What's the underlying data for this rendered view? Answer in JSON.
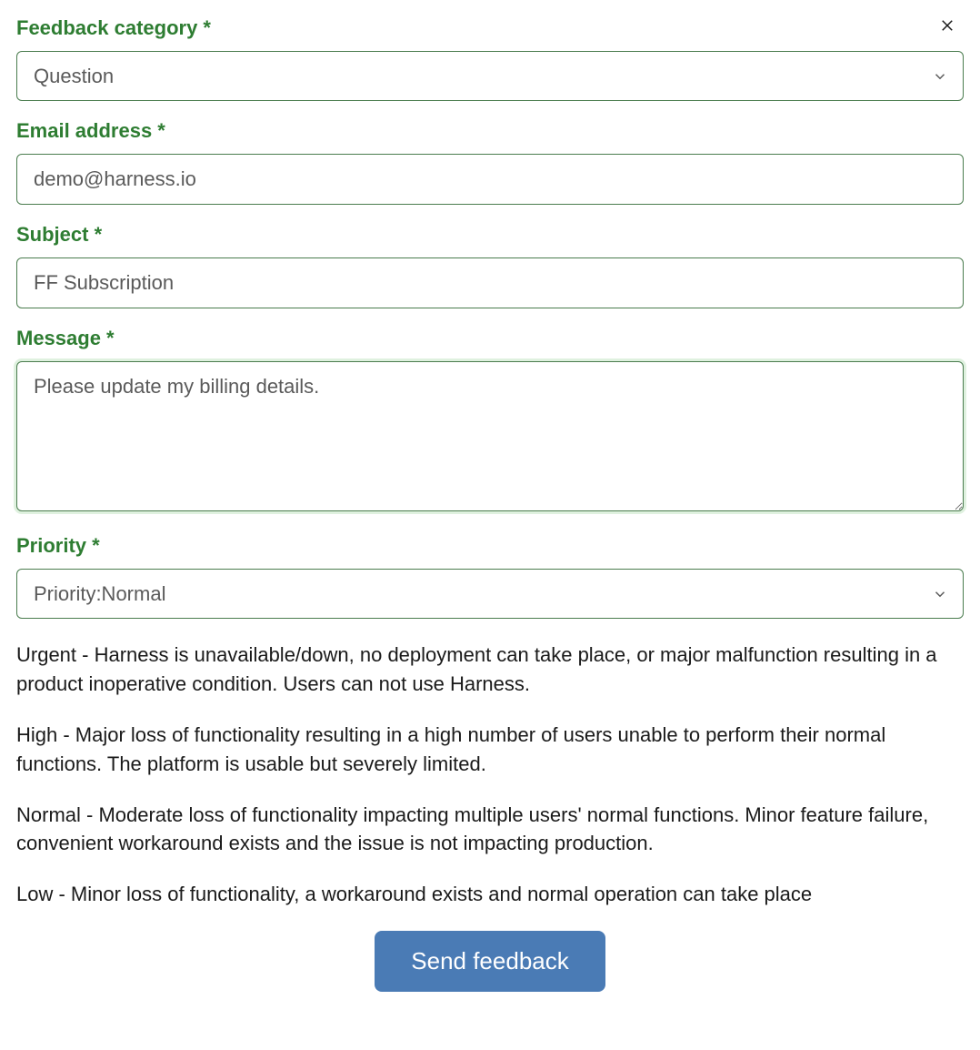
{
  "close": {
    "aria": "Close"
  },
  "fields": {
    "category": {
      "label": "Feedback category *",
      "value": "Question"
    },
    "email": {
      "label": "Email address *",
      "value": "demo@harness.io"
    },
    "subject": {
      "label": "Subject *",
      "value": "FF Subscription"
    },
    "message": {
      "label": "Message *",
      "value": "Please update my billing details."
    },
    "priority": {
      "label": "Priority *",
      "value": "Priority:Normal"
    }
  },
  "priority_descriptions": [
    "Urgent - Harness is unavailable/down, no deployment can take place, or major malfunction resulting in a product inoperative condition. Users can not use Harness.",
    "High - Major loss of functionality resulting in a high number of users unable to perform their normal functions. The platform is usable but severely limited.",
    "Normal - Moderate loss of functionality impacting multiple users' normal functions. Minor feature failure, convenient workaround exists and the issue is not impacting production.",
    "Low - Minor loss of functionality, a workaround exists and normal operation can take place"
  ],
  "submit": {
    "label": "Send feedback"
  }
}
